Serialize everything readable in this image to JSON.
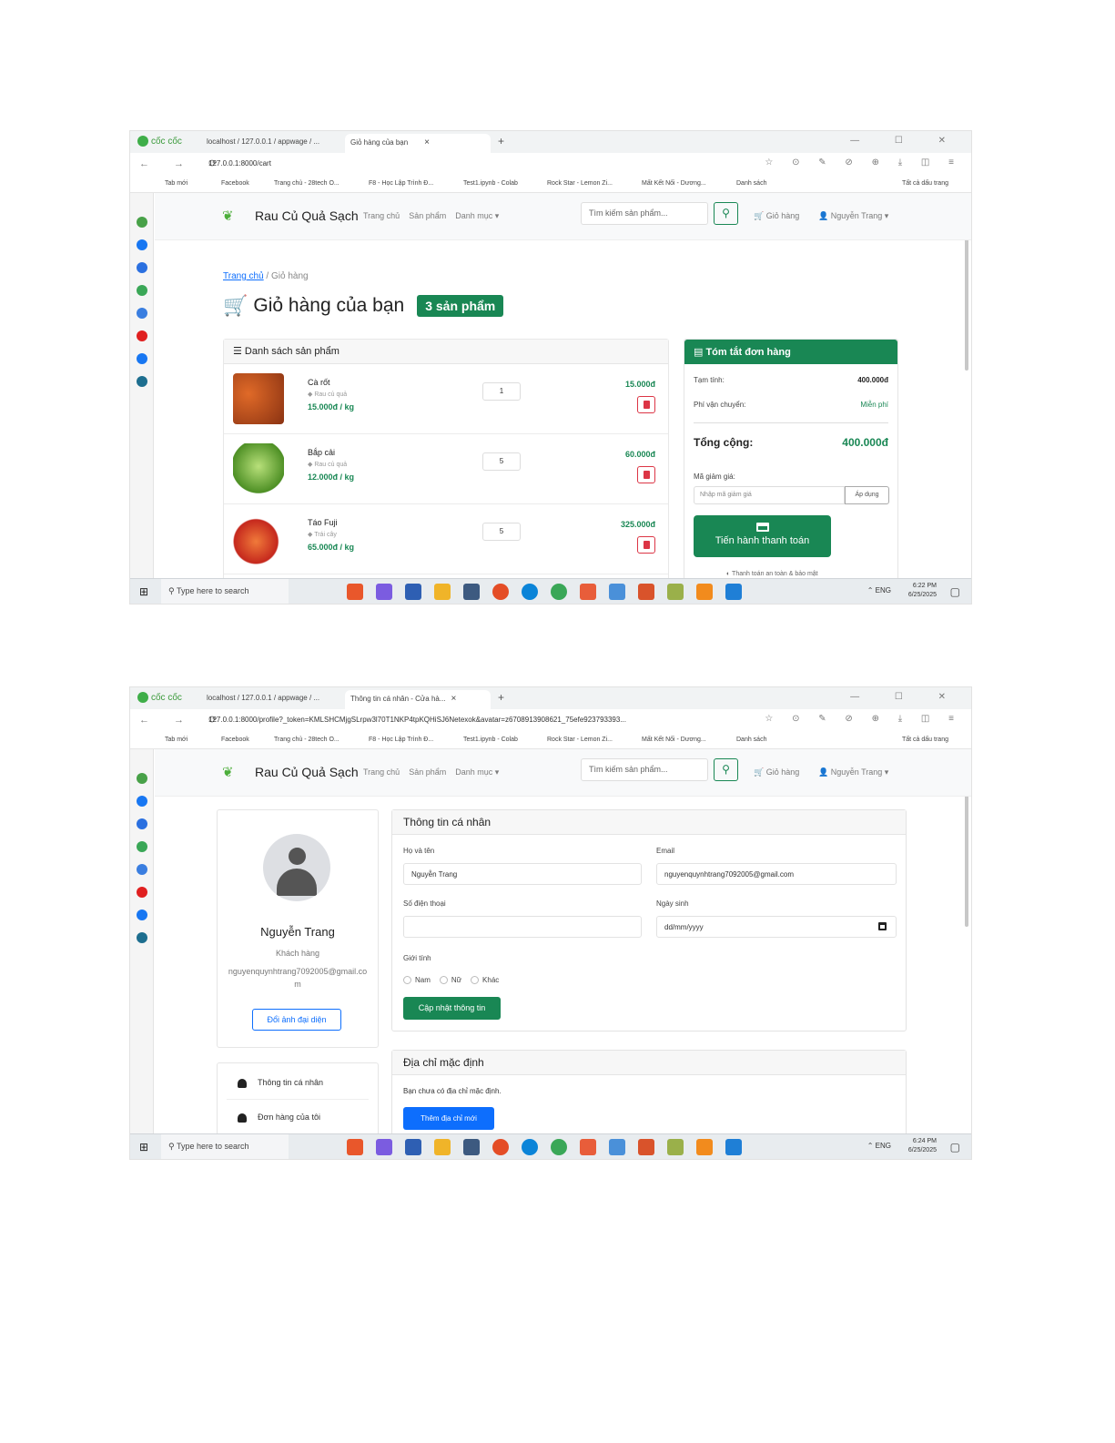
{
  "browser": {
    "brand": "cốc cốc",
    "tab_localhost": "localhost / 127.0.0.1 / appwage / ...",
    "screenshot1": {
      "active_tab": "Giỏ hàng của bạn",
      "url": "127.0.0.1:8000/cart"
    },
    "screenshot2": {
      "active_tab": "Thông tin cá nhân - Cửa hà...",
      "url": "127.0.0.1:8000/profile?_token=KMLSHCMjgSLrpw3l70T1NKP4tpKQHiSJ6Netexok&avatar=z6708913908621_75efe923793393..."
    },
    "bookmarks": [
      "Tab mới",
      "Facebook",
      "Trang chủ - 28tech O...",
      "F8 - Học Lập Trình Đ...",
      "Test1.ipynb - Colab",
      "Rock Star - Lemon Zi...",
      "Mất Kết Nối - Dương...",
      "Danh sách"
    ],
    "bookmarks_other": "Tất cả dấu trang"
  },
  "taskbar": {
    "search_placeholder": "Type here to search",
    "language": "ENG",
    "time1": "6:22 PM",
    "time2": "6:24 PM",
    "date": "6/25/2025"
  },
  "site": {
    "logo": "Rau Củ Quả Sạch",
    "nav": [
      "Trang chủ",
      "Sản phẩm",
      "Danh mục ▾"
    ],
    "search_placeholder": "Tìm kiếm sản phẩm...",
    "cart": "Giỏ hàng",
    "user": "Nguyễn Trang ▾"
  },
  "cart": {
    "breadcrumb_home": "Trang chủ",
    "breadcrumb_current": "Giỏ hàng",
    "title": "Giỏ hàng của bạn",
    "badge": "3 sản phẩm",
    "list_title": "Danh sách sản phẩm",
    "items": [
      {
        "name": "Cà rốt",
        "category": "Rau củ quả",
        "unit_price": "15.000đ / kg",
        "qty": "1",
        "total": "15.000đ",
        "color": "#c8501d"
      },
      {
        "name": "Bắp cải",
        "category": "Rau củ quả",
        "unit_price": "12.000đ / kg",
        "qty": "5",
        "total": "60.000đ",
        "color": "#6fb33d"
      },
      {
        "name": "Táo Fuji",
        "category": "Trái cây",
        "unit_price": "65.000đ / kg",
        "qty": "5",
        "total": "325.000đ",
        "color": "#d6412a"
      }
    ],
    "summary": {
      "title": "Tóm tắt đơn hàng",
      "subtotal_label": "Tạm tính:",
      "subtotal": "400.000đ",
      "shipping_label": "Phí vận chuyển:",
      "shipping": "Miễn phí",
      "total_label": "Tổng cộng:",
      "total": "400.000đ",
      "coupon_label": "Mã giảm giá:",
      "coupon_placeholder": "Nhập mã giảm giá",
      "apply": "Áp dụng",
      "checkout": "Tiến hành thanh toán",
      "secure": "Thanh toán an toàn & bảo mật"
    }
  },
  "profile": {
    "name": "Nguyễn Trang",
    "role": "Khách hàng",
    "email_display": "nguyenquynhtrang7092005@gmail.com",
    "change_avatar": "Đổi ảnh đại diện",
    "menu": [
      "Thông tin cá nhân",
      "Đơn hàng của tôi"
    ],
    "info_title": "Thông tin cá nhân",
    "fullname_label": "Họ và tên",
    "fullname_value": "Nguyễn Trang",
    "email_label": "Email",
    "email_value": "nguyenquynhtrang7092005@gmail.com",
    "phone_label": "Số điện thoại",
    "phone_value": "",
    "dob_label": "Ngày sinh",
    "dob_placeholder": "dd/mm/yyyy",
    "gender_label": "Giới tính",
    "genders": [
      "Nam",
      "Nữ",
      "Khác"
    ],
    "update_button": "Cập nhật thông tin",
    "address_title": "Địa chỉ mặc định",
    "address_empty": "Bạn chưa có địa chỉ mặc định.",
    "add_address": "Thêm địa chỉ mới"
  },
  "colors": {
    "primary_green": "#198754",
    "primary_blue": "#0d6efd",
    "danger": "#dc3545"
  }
}
